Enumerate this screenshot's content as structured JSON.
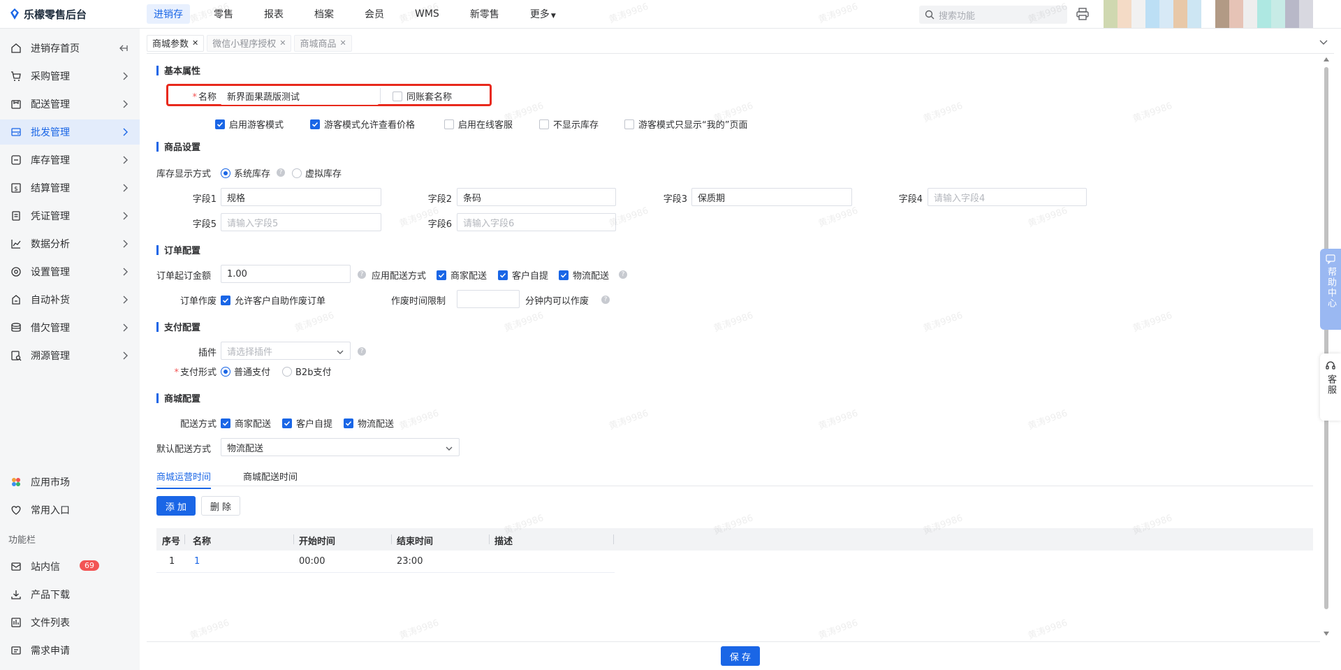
{
  "app": {
    "title": "乐檬零售后台"
  },
  "topnav": {
    "items": [
      {
        "label": "进销存",
        "active": true
      },
      {
        "label": "零售"
      },
      {
        "label": "报表"
      },
      {
        "label": "档案"
      },
      {
        "label": "会员"
      },
      {
        "label": "WMS"
      },
      {
        "label": "新零售"
      },
      {
        "label": "更多"
      }
    ],
    "search_placeholder": "搜索功能"
  },
  "sidebar": {
    "items": [
      {
        "label": "进销存首页",
        "icon": "home-icon"
      },
      {
        "label": "采购管理",
        "icon": "cart-icon"
      },
      {
        "label": "配送管理",
        "icon": "delivery-icon"
      },
      {
        "label": "批发管理",
        "icon": "wholesale-icon",
        "active": true
      },
      {
        "label": "库存管理",
        "icon": "inventory-icon"
      },
      {
        "label": "结算管理",
        "icon": "settlement-icon"
      },
      {
        "label": "凭证管理",
        "icon": "voucher-icon"
      },
      {
        "label": "数据分析",
        "icon": "chart-icon"
      },
      {
        "label": "设置管理",
        "icon": "settings-icon"
      },
      {
        "label": "自动补货",
        "icon": "replenish-icon"
      },
      {
        "label": "借欠管理",
        "icon": "debt-icon"
      },
      {
        "label": "溯源管理",
        "icon": "trace-icon"
      }
    ],
    "bottom": {
      "app_market": "应用市场",
      "favorites": "常用入口",
      "section_label": "功能栏",
      "messages": "站内信",
      "messages_badge": "69",
      "downloads": "产品下载",
      "files": "文件列表",
      "requests": "需求申请"
    }
  },
  "tabs": [
    {
      "label": "商城参数",
      "active": true
    },
    {
      "label": "微信小程序授权"
    },
    {
      "label": "商城商品"
    }
  ],
  "basic": {
    "title": "基本属性",
    "name_label": "名称",
    "name_value": "新界面果蔬版测试",
    "same_account_label": "同账套名称",
    "options": [
      {
        "label": "启用游客模式",
        "checked": true
      },
      {
        "label": "游客模式允许查看价格",
        "checked": true
      },
      {
        "label": "启用在线客服",
        "checked": false
      },
      {
        "label": "不显示库存",
        "checked": false
      },
      {
        "label": "游客模式只显示“我的”页面",
        "checked": false
      }
    ]
  },
  "goods": {
    "title": "商品设置",
    "stock_label": "库存显示方式",
    "stock_options": [
      "系统库存",
      "虚拟库存"
    ],
    "fields": [
      {
        "label": "字段1",
        "value": "规格",
        "placeholder": ""
      },
      {
        "label": "字段2",
        "value": "条码",
        "placeholder": ""
      },
      {
        "label": "字段3",
        "value": "保质期",
        "placeholder": ""
      },
      {
        "label": "字段4",
        "value": "",
        "placeholder": "请输入字段4"
      },
      {
        "label": "字段5",
        "value": "",
        "placeholder": "请输入字段5"
      },
      {
        "label": "字段6",
        "value": "",
        "placeholder": "请输入字段6"
      }
    ]
  },
  "order": {
    "title": "订单配置",
    "min_amount_label": "订单起订金额",
    "min_amount_value": "1.00",
    "delivery_label": "应用配送方式",
    "delivery_options": [
      "商家配送",
      "客户自提",
      "物流配送"
    ],
    "cancel_label": "订单作废",
    "cancel_option": "允许客户自助作废订单",
    "cancel_limit_label": "作废时间限制",
    "cancel_limit_suffix": "分钟内可以作废"
  },
  "payment": {
    "title": "支付配置",
    "plugin_label": "插件",
    "plugin_placeholder": "请选择插件",
    "method_label": "支付形式",
    "method_options": [
      "普通支付",
      "B2b支付"
    ]
  },
  "mall": {
    "title": "商城配置",
    "delivery_label": "配送方式",
    "delivery_options": [
      "商家配送",
      "客户自提",
      "物流配送"
    ],
    "default_delivery_label": "默认配送方式",
    "default_delivery_value": "物流配送"
  },
  "sub_tabs": [
    "商城运营时间",
    "商城配送时间"
  ],
  "actions": {
    "add": "添 加",
    "delete": "删 除",
    "save": "保 存"
  },
  "table": {
    "headers": [
      "序号",
      "名称",
      "开始时间",
      "结束时间",
      "描述"
    ],
    "rows": [
      {
        "index": "1",
        "name": "1",
        "start": "00:00",
        "end": "23:00",
        "desc": ""
      }
    ]
  },
  "float": {
    "help_center": "帮助中心",
    "customer_service": "客服"
  },
  "watermark": "黄涛9986",
  "colors": {
    "primary": "#1a66e6",
    "highlight": "#e8291c",
    "badge": "#f25454"
  }
}
